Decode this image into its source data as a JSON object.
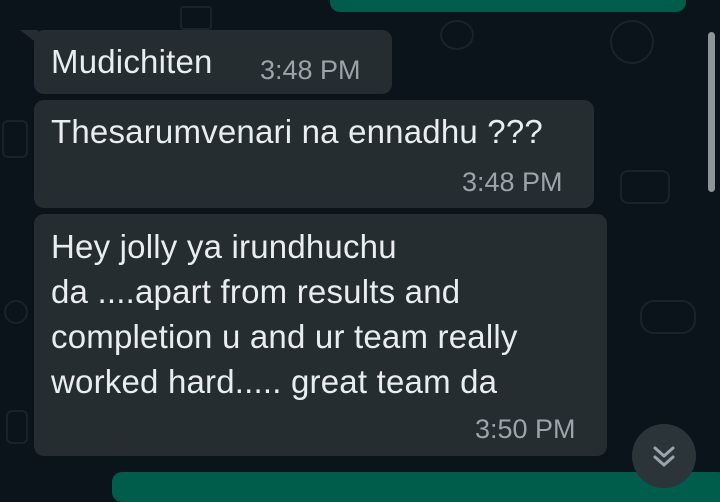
{
  "messages": [
    {
      "text": "Mudichiten",
      "time": "3:48 PM"
    },
    {
      "text": "Thesarumvenari na ennadhu ???",
      "time": "3:48 PM"
    },
    {
      "text_lines": [
        "Hey jolly ya irundhuchu",
        "da ....apart from results and",
        "completion u and ur team really",
        "worked hard..... great team da"
      ],
      "time": "3:50 PM"
    }
  ],
  "icons": {
    "scroll_down": "double-chevron-down-icon"
  },
  "colors": {
    "background": "#0b141a",
    "incoming_bubble": "#262d31",
    "outgoing_bubble": "#005c4b",
    "time_text": "#9aa5ab"
  }
}
